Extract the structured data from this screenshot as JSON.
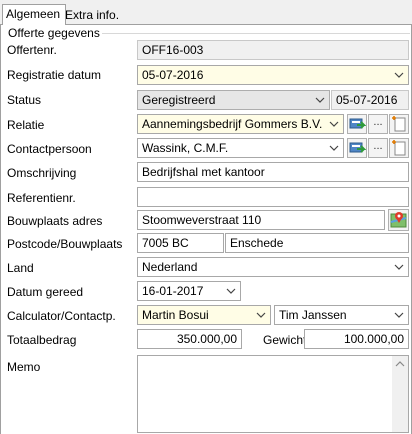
{
  "tabs": [
    "Algemeen",
    "Extra info."
  ],
  "section_title": "Offerte gegevens",
  "fields": {
    "offertenr": {
      "label": "Offertenr.",
      "value": "OFF16-003"
    },
    "registratie": {
      "label": "Registratie datum",
      "value": "05-07-2016"
    },
    "status": {
      "label": "Status",
      "value": "Geregistreerd",
      "date": "05-07-2016"
    },
    "relatie": {
      "label": "Relatie",
      "value": "Aannemingsbedrijf Gommers B.V."
    },
    "contact": {
      "label": "Contactpersoon",
      "value": "Wassink, C.M.F."
    },
    "omschrijving": {
      "label": "Omschrijving",
      "value": "Bedrijfshal met kantoor"
    },
    "referentie": {
      "label": "Referentienr.",
      "value": ""
    },
    "bouwplaats": {
      "label": "Bouwplaats adres",
      "value": "Stoomweverstraat 110"
    },
    "postcode": {
      "label": "Postcode/Bouwplaats",
      "value": "7005 BC",
      "plaats": "Enschede"
    },
    "land": {
      "label": "Land",
      "value": "Nederland"
    },
    "gereed": {
      "label": "Datum gereed",
      "value": "16-01-2017"
    },
    "calculator": {
      "label": "Calculator/Contactp.",
      "value": "Martin Bosui",
      "contact": "Tim Janssen"
    },
    "totaal": {
      "label": "Totaalbedrag",
      "value": "350.000,00",
      "gewicht_label": "Gewicht",
      "gewicht": "100.000,00"
    },
    "memo": {
      "label": "Memo",
      "value": ""
    }
  },
  "ellipsis": "...",
  "icons": {
    "chevron": "chevron-down-icon",
    "lookup": "card-lookup-icon",
    "new": "new-document-icon",
    "map": "map-pin-icon"
  }
}
